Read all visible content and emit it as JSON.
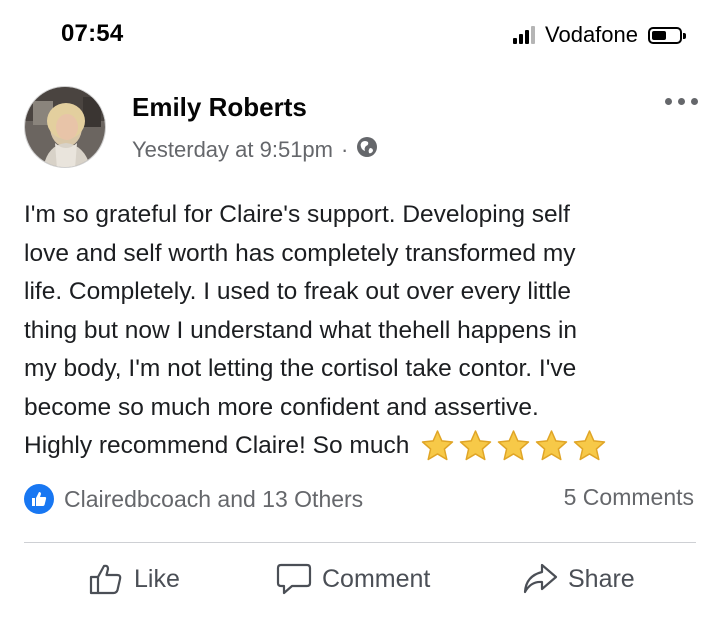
{
  "status_bar": {
    "time": "07:54",
    "carrier": "Vodafone"
  },
  "post": {
    "author": "Emily Roberts",
    "timestamp": "Yesterday at 9:51pm",
    "separator": "·",
    "privacy_icon": "globe-icon",
    "lines": [
      "I'm so grateful for Claire's support. Developing self",
      "love and self worth has completely transformed my",
      "life. Completely. I used to freak out over every little",
      "thing but now I understand what thehell happens in",
      "my body, I'm not letting the cortisol take contor. I've",
      "become so much more confident and assertive.",
      "Highly recommend Claire! So much"
    ],
    "star_count": 5,
    "reactions_text": "Clairedbcoach and 13 Others",
    "comments_text": "5 Comments"
  },
  "actions": {
    "like": "Like",
    "comment": "Comment",
    "share": "Share"
  },
  "colors": {
    "accent": "#1877f2",
    "secondary_text": "#65676b",
    "star": "#f7c948"
  }
}
